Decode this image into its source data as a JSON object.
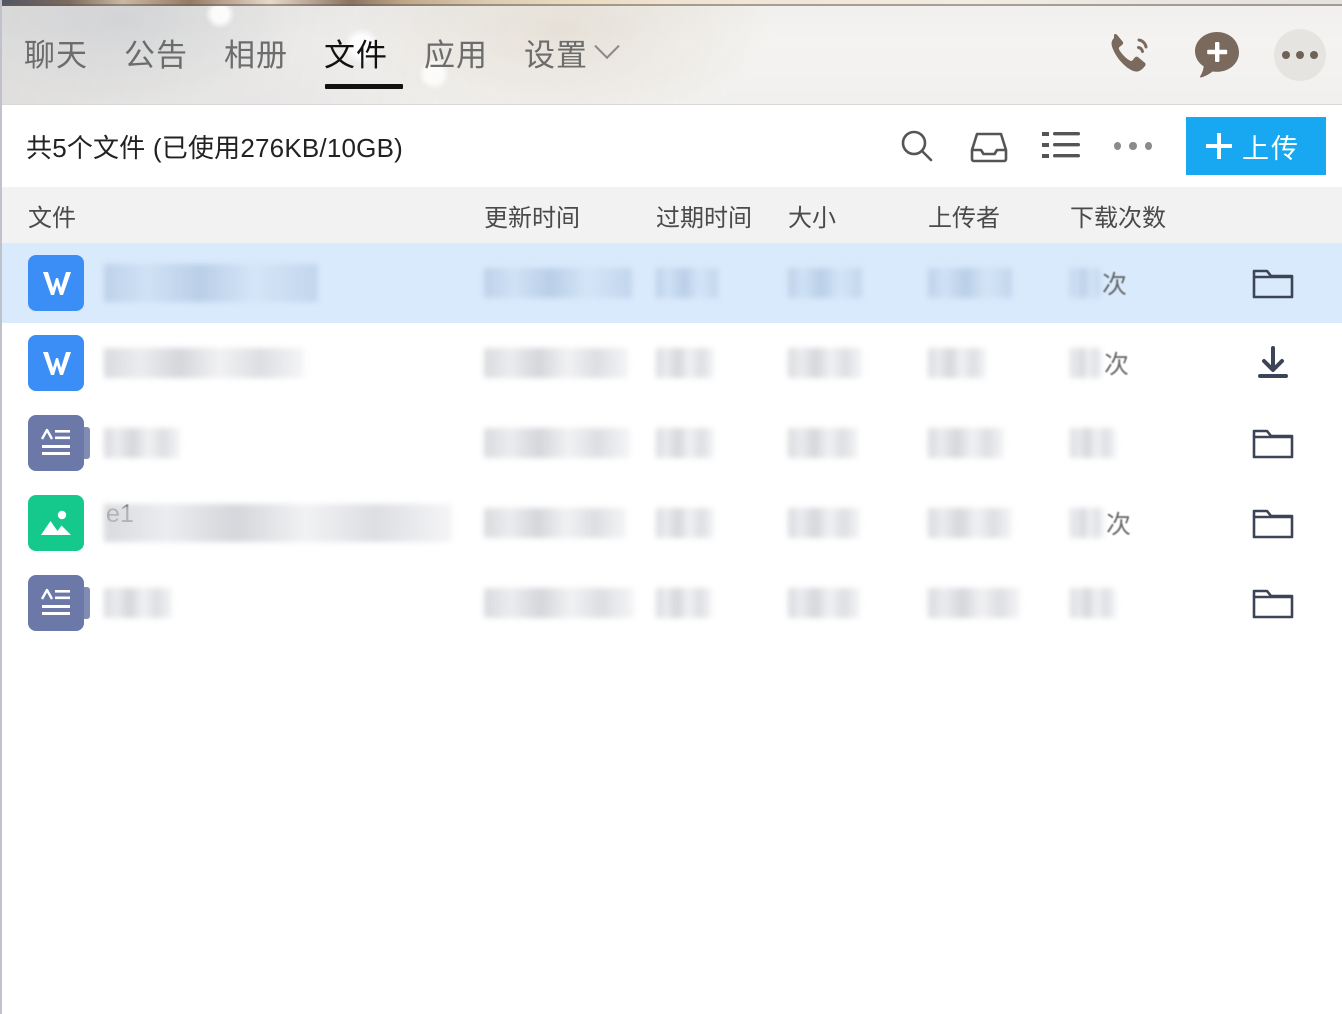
{
  "header": {
    "tabs": [
      {
        "label": "聊天",
        "active": false
      },
      {
        "label": "公告",
        "active": false
      },
      {
        "label": "相册",
        "active": false
      },
      {
        "label": "文件",
        "active": true
      },
      {
        "label": "应用",
        "active": false
      },
      {
        "label": "设置",
        "active": false,
        "chevron": true
      }
    ],
    "actions": [
      {
        "name": "phone-call-icon",
        "label": "通话"
      },
      {
        "name": "new-chat-icon",
        "label": "发起聊天"
      },
      {
        "name": "more-options-icon",
        "label": "更多"
      }
    ]
  },
  "toolbar": {
    "file_count_text": "共5个文件 (已使用276KB/10GB)",
    "total_files": 5,
    "used_storage": "276KB",
    "total_storage": "10GB",
    "search_label": "搜索",
    "inbox_label": "收件箱",
    "list_view_label": "列表视图",
    "more_label": "更多",
    "upload_label": "上传"
  },
  "table": {
    "columns": [
      {
        "key": "file",
        "label": "文件"
      },
      {
        "key": "updated",
        "label": "更新时间"
      },
      {
        "key": "expire",
        "label": "过期时间"
      },
      {
        "key": "size",
        "label": "大小"
      },
      {
        "key": "uploader",
        "label": "上传者"
      },
      {
        "key": "count",
        "label": "下载次数"
      }
    ],
    "rows": [
      {
        "icon": "wps-word-icon",
        "icon_type": "wps",
        "name": "",
        "updated": "",
        "expire": "",
        "size": "",
        "uploader": "",
        "count": "",
        "count_unit": "次",
        "action": "folder-icon",
        "selected": true
      },
      {
        "icon": "wps-word-icon",
        "icon_type": "wps",
        "name": "",
        "updated": "",
        "expire": "",
        "size": "",
        "uploader": "",
        "count": "",
        "count_unit": "次",
        "action": "download-icon",
        "selected": false
      },
      {
        "icon": "document-icon",
        "icon_type": "doc",
        "name": "",
        "updated": "",
        "expire": "",
        "size": "",
        "uploader": "",
        "count": "",
        "count_unit": "",
        "action": "folder-icon",
        "selected": false
      },
      {
        "icon": "image-file-icon",
        "icon_type": "img",
        "name": "e1",
        "updated": "",
        "expire": "",
        "size": "",
        "uploader": "",
        "count": "",
        "count_unit": "次",
        "action": "folder-icon",
        "selected": false
      },
      {
        "icon": "document-icon",
        "icon_type": "doc",
        "name": "",
        "updated": "",
        "expire": "",
        "size": "",
        "uploader": "",
        "count": "",
        "count_unit": "",
        "action": "folder-icon",
        "selected": false
      }
    ]
  },
  "colors": {
    "accent_blue": "#18a8f2",
    "selected_row": "#d9eafc",
    "wps_icon": "#3a8ef6",
    "doc_icon": "#6b78a8",
    "image_icon": "#15c98c",
    "header_bg": "#f1f0ee",
    "thead_bg": "#f2f2f2"
  }
}
